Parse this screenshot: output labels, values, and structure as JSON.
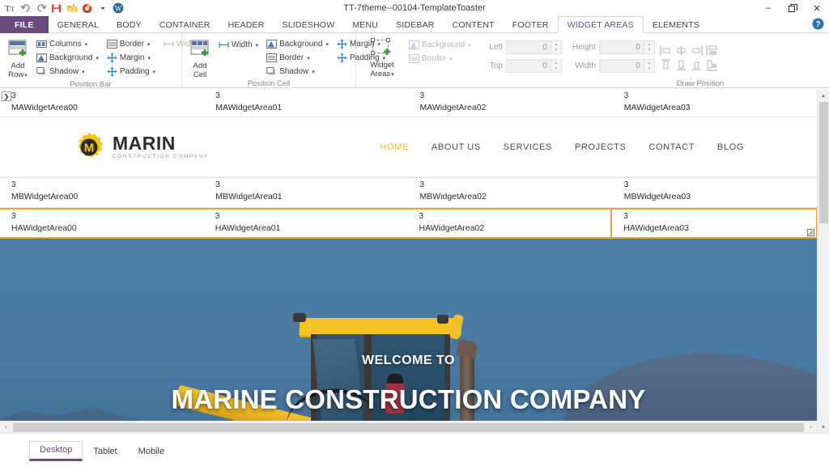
{
  "window": {
    "title": "TT-7theme--00104-TemplateToaster",
    "controls": {
      "minimize": "–",
      "restore": "❐",
      "close": "✕"
    },
    "help": "?"
  },
  "quick_access": [
    {
      "name": "text-tool-icon",
      "glyph": "Tᴛ"
    },
    {
      "name": "undo-icon",
      "glyph": "↶"
    },
    {
      "name": "redo-icon",
      "glyph": "↷"
    },
    {
      "name": "save-icon",
      "glyph": "Ὃe"
    },
    {
      "name": "open-folder-icon",
      "glyph": "Ὄ2"
    },
    {
      "name": "preview-browser-icon",
      "glyph": "●"
    },
    {
      "name": "dropdown-caret-icon",
      "glyph": "▾"
    },
    {
      "name": "wordpress-icon",
      "glyph": "W"
    }
  ],
  "ribbon_tabs": [
    {
      "label": "FILE",
      "active": false,
      "file": true
    },
    {
      "label": "GENERAL",
      "active": false
    },
    {
      "label": "BODY",
      "active": false
    },
    {
      "label": "CONTAINER",
      "active": false
    },
    {
      "label": "HEADER",
      "active": false
    },
    {
      "label": "SLIDESHOW",
      "active": false
    },
    {
      "label": "MENU",
      "active": false
    },
    {
      "label": "SIDEBAR",
      "active": false
    },
    {
      "label": "CONTENT",
      "active": false
    },
    {
      "label": "FOOTER",
      "active": false
    },
    {
      "label": "WIDGET AREAS",
      "active": true
    },
    {
      "label": "ELEMENTS",
      "active": false
    }
  ],
  "ribbon": {
    "groups": [
      {
        "title": "Position Bar",
        "big": {
          "label_line1": "Add",
          "label_line2": "Row",
          "caret": "▾",
          "icon": "add-row-icon"
        },
        "col1": [
          {
            "label": "Columns",
            "icon": "columns-icon",
            "caret": "▾",
            "dim": false
          },
          {
            "label": "Background",
            "icon": "background-icon",
            "caret": "▾",
            "dim": false
          },
          {
            "label": "Shadow",
            "icon": "shadow-icon",
            "caret": "▾",
            "dim": false
          }
        ],
        "col2": [
          {
            "label": "Border",
            "icon": "border-icon",
            "caret": "▾",
            "dim": false
          },
          {
            "label": "Margin",
            "icon": "margin-icon",
            "caret": "▾",
            "dim": false
          },
          {
            "label": "Padding",
            "icon": "padding-icon",
            "caret": "▾",
            "dim": false
          }
        ],
        "col3": [
          {
            "label": "Width",
            "icon": "width-icon",
            "caret": "▾",
            "dim": true
          }
        ]
      },
      {
        "title": "Position Cell",
        "big": {
          "label_line1": "Add",
          "label_line2": "Cell",
          "caret": "",
          "icon": "add-cell-icon"
        },
        "col1": [
          {
            "label": "Width",
            "icon": "width-icon",
            "caret": "▾",
            "dim": false
          }
        ],
        "col2": [
          {
            "label": "Background",
            "icon": "background-icon",
            "caret": "▾",
            "dim": false
          },
          {
            "label": "Border",
            "icon": "border-icon",
            "caret": "▾",
            "dim": false
          },
          {
            "label": "Shadow",
            "icon": "shadow-icon",
            "caret": "▾",
            "dim": false
          }
        ],
        "col3": [
          {
            "label": "Margin",
            "icon": "margin-icon",
            "caret": "▾",
            "dim": false
          },
          {
            "label": "Padding",
            "icon": "padding-icon",
            "caret": "▾",
            "dim": false
          }
        ]
      },
      {
        "title": "",
        "big": {
          "label_line1": "Widget",
          "label_line2": "Areas",
          "caret": "▾",
          "icon": "widget-areas-icon"
        },
        "col1": [],
        "col2": [
          {
            "label": "Background",
            "icon": "background-icon",
            "caret": "▾",
            "dim": true
          },
          {
            "label": "Border",
            "icon": "border-icon",
            "caret": "▾",
            "dim": true
          }
        ],
        "col3": []
      }
    ],
    "draw_position": {
      "title": "Draw Position",
      "fields": [
        {
          "label": "Left",
          "value": "0"
        },
        {
          "label": "Top",
          "value": "0"
        },
        {
          "label": "Height",
          "value": "0"
        },
        {
          "label": "Width",
          "value": "0"
        }
      ],
      "align_buttons_row1": [
        "align-left-icon",
        "align-center-h-icon",
        "align-right-icon",
        "distribute-h-icon"
      ],
      "align_buttons_row2": [
        "align-top-icon",
        "align-middle-v-icon",
        "align-bottom-icon",
        "distribute-v-icon"
      ],
      "spin_up": "▴",
      "spin_down": "▾"
    }
  },
  "canvas": {
    "expander_glyph": "❯",
    "rows": [
      {
        "id": "MA",
        "selected_index": -1,
        "cells": [
          {
            "num": "3",
            "name": "MAWidgetArea00"
          },
          {
            "num": "3",
            "name": "MAWidgetArea01"
          },
          {
            "num": "3",
            "name": "MAWidgetArea02"
          },
          {
            "num": "3",
            "name": "MAWidgetArea03"
          }
        ]
      },
      {
        "id": "MB",
        "selected_index": -1,
        "cells": [
          {
            "num": "3",
            "name": "MBWidgetArea00"
          },
          {
            "num": "3",
            "name": "MBWidgetArea01"
          },
          {
            "num": "3",
            "name": "MBWidgetArea02"
          },
          {
            "num": "3",
            "name": "MBWidgetArea03"
          }
        ]
      },
      {
        "id": "HA",
        "selected_index": 3,
        "cells": [
          {
            "num": "3",
            "name": "HAWidgetArea00"
          },
          {
            "num": "3",
            "name": "HAWidgetArea01"
          },
          {
            "num": "3",
            "name": "HAWidgetArea02"
          },
          {
            "num": "3",
            "name": "HAWidgetArea03"
          }
        ]
      }
    ],
    "resize_handle_glyph": "⟲"
  },
  "site": {
    "logo": {
      "mark_letter": "M",
      "brand": "MARIN",
      "tagline": "CONSTRUCTION COMPANY"
    },
    "nav": [
      {
        "label": "HOME",
        "active": true
      },
      {
        "label": "ABOUT US",
        "active": false
      },
      {
        "label": "SERVICES",
        "active": false
      },
      {
        "label": "PROJECTS",
        "active": false
      },
      {
        "label": "CONTACT",
        "active": false
      },
      {
        "label": "BLOG",
        "active": false
      }
    ],
    "hero": {
      "subtitle": "WELCOME TO",
      "title": "MARINE CONSTRUCTION COMPANY",
      "scroll_top_glyph": "➤"
    }
  },
  "scrollbars": {
    "up": "▴",
    "down": "▾",
    "left": "‹",
    "right": "›"
  },
  "statusbar": {
    "device_tabs": [
      {
        "label": "Desktop",
        "active": true
      },
      {
        "label": "Tablet",
        "active": false
      },
      {
        "label": "Mobile",
        "active": false
      }
    ]
  },
  "colors": {
    "accent_purple": "#6b4a7f",
    "selection_orange": "#e8a33d",
    "brand_yellow": "#f5c518",
    "nav_active": "#f0b93c",
    "hero_sky": "#4a7ba4"
  }
}
